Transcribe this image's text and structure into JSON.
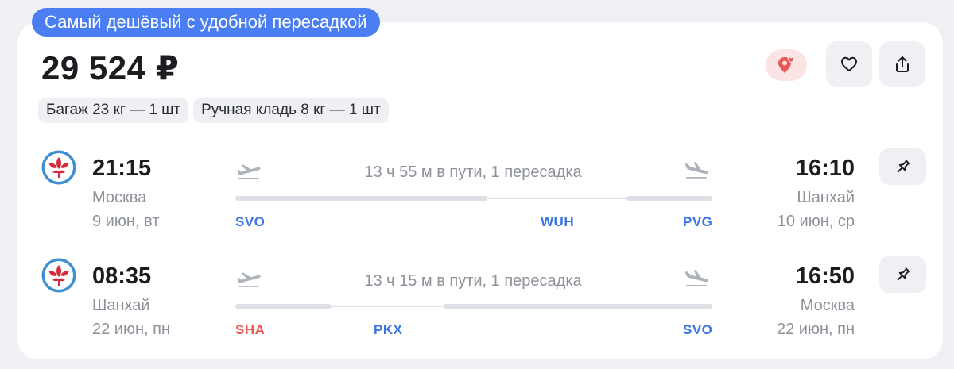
{
  "offer": {
    "badge": "Самый дешёвый с удобной пересадкой",
    "price": "29 524 ₽",
    "tags": [
      "Багаж 23 кг — 1 шт",
      "Ручная кладь 8 кг — 1 шт"
    ]
  },
  "colors": {
    "accent": "#4a7ef2",
    "airport_code": "#3b74e4",
    "airport_code_alt": "#ea5757",
    "promo_bg": "#fde4e4",
    "promo_icon": "#ea5757"
  },
  "icons": {
    "promo": "location-heart-icon",
    "favorite": "heart-icon",
    "share": "share-icon",
    "pin": "pin-icon",
    "takeoff": "takeoff-plane-icon",
    "landing": "landing-plane-icon",
    "airline": "china-southern-logo"
  },
  "segments": [
    {
      "dep_time": "21:15",
      "dep_city": "Москва",
      "dep_date": "9 июн, вт",
      "duration": "13 ч 55 м в пути, 1 пересадка",
      "codes": [
        "SVO",
        "WUH",
        "PVG"
      ],
      "arr_time": "16:10",
      "arr_city": "Шанхай",
      "arr_date": "10 июн, ср"
    },
    {
      "dep_time": "08:35",
      "dep_city": "Шанхай",
      "dep_date": "22 июн, пн",
      "duration": "13 ч 15 м в пути, 1 пересадка",
      "codes": [
        "SHA",
        "PKX",
        "SVO"
      ],
      "arr_time": "16:50",
      "arr_city": "Москва",
      "arr_date": "22 июн, пн"
    }
  ]
}
